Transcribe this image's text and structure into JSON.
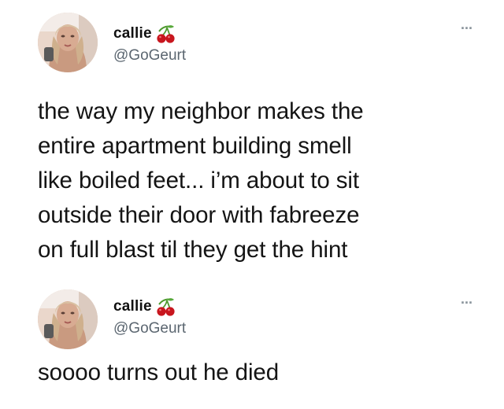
{
  "tweets": [
    {
      "display_name": "callie",
      "badge_icon": "cherry-emoji",
      "handle": "@GoGeurt",
      "more_label": "...",
      "text": "the way my neighbor makes the\nentire apartment building smell\nlike boiled feet... i’m about to sit\noutside their door with fabreeze\non full blast til they get the hint"
    },
    {
      "display_name": "callie",
      "badge_icon": "cherry-emoji",
      "handle": "@GoGeurt",
      "more_label": "...",
      "text": "soooo turns out he died"
    }
  ],
  "colors": {
    "text": "#141414",
    "handle": "#5b6670",
    "more": "#8a949c",
    "cherry": "#c8161e",
    "stem": "#4f9a2f"
  }
}
